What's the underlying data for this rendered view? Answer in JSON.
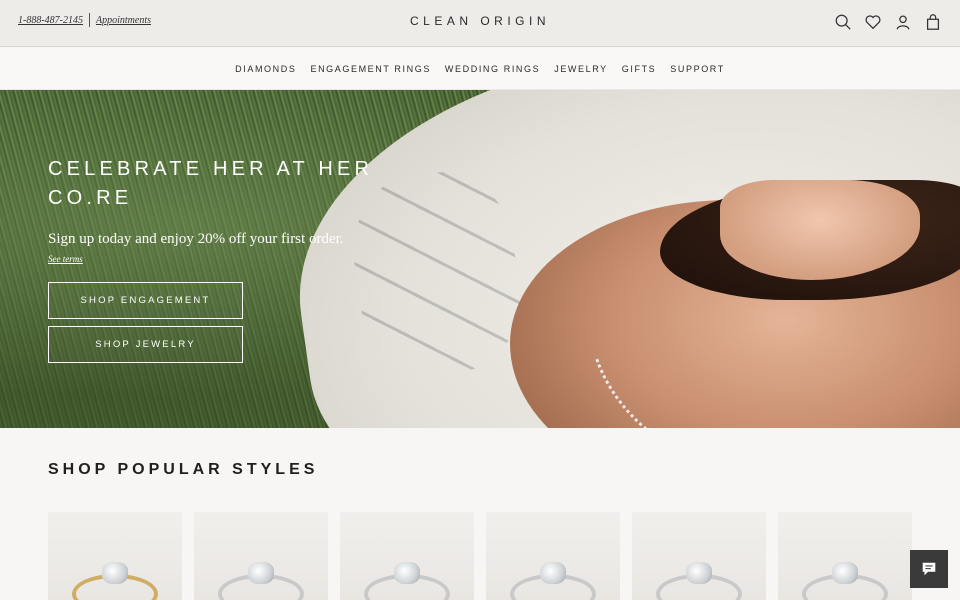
{
  "header": {
    "phone": "1-888-487-2145",
    "appointments": "Appointments",
    "brand": "CLEAN ORIGIN",
    "icons": [
      "search-icon",
      "heart-icon",
      "user-icon",
      "bag-icon"
    ]
  },
  "nav": {
    "items": [
      {
        "label": "DIAMONDS"
      },
      {
        "label": "ENGAGEMENT RINGS"
      },
      {
        "label": "WEDDING RINGS"
      },
      {
        "label": "JEWELRY"
      },
      {
        "label": "GIFTS"
      },
      {
        "label": "SUPPORT"
      }
    ]
  },
  "hero": {
    "headline": "CELEBRATE HER AT HER CO.RE",
    "subline": "Sign up today and enjoy 20% off your first order.",
    "terms": "See terms",
    "cta_engagement": "SHOP ENGAGEMENT",
    "cta_jewelry": "SHOP JEWELRY"
  },
  "popular": {
    "title": "SHOP POPULAR STYLES"
  },
  "colors": {
    "topbar_bg": "#eeece8",
    "page_bg": "#f8f6f4",
    "chat_bg": "#3a3a3a"
  }
}
